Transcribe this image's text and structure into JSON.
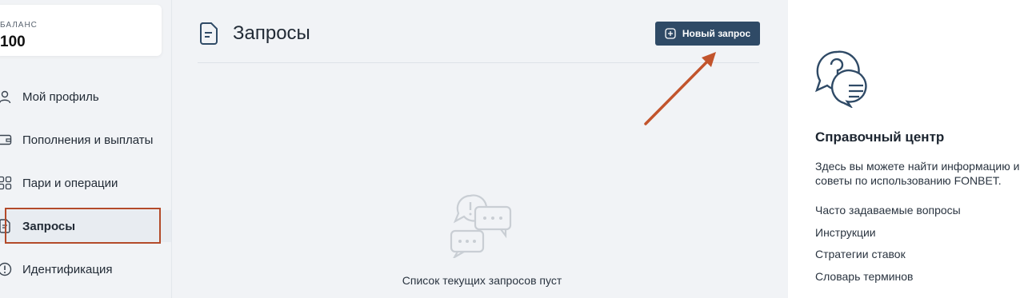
{
  "balance": {
    "label": "БАЛАНС",
    "value": "100"
  },
  "sidebar": {
    "items": [
      {
        "label": "Мой профиль",
        "icon": "user-icon"
      },
      {
        "label": "Пополнения и выплаты",
        "icon": "wallet-icon"
      },
      {
        "label": "Пари и операции",
        "icon": "grid-icon"
      },
      {
        "label": "Запросы",
        "icon": "document-icon",
        "active": true
      },
      {
        "label": "Идентификация",
        "icon": "alert-circle-icon"
      }
    ]
  },
  "main": {
    "title": "Запросы",
    "new_request_label": "Новый запрос",
    "empty_text": "Список текущих запросов пуст"
  },
  "help": {
    "title": "Справочный центр",
    "description": "Здесь вы можете найти информацию и советы по использованию FONBET.",
    "links": [
      "Часто задаваемые вопросы",
      "Инструкции",
      "Стратегии ставок",
      "Словарь терминов"
    ]
  },
  "colors": {
    "accent_button": "#2f4a66",
    "highlight_outline": "#b34a2a",
    "annotation_arrow": "#c2542c",
    "help_icon": "#2f4a66"
  }
}
